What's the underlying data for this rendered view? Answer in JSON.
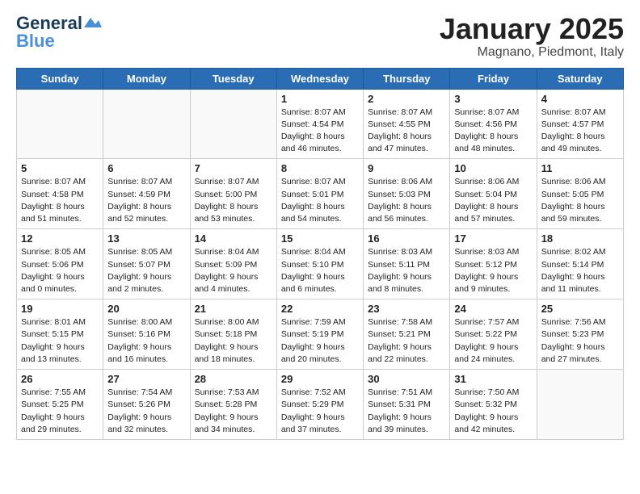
{
  "header": {
    "logo_line1": "General",
    "logo_line2": "Blue",
    "month_title": "January 2025",
    "location": "Magnano, Piedmont, Italy"
  },
  "weekdays": [
    "Sunday",
    "Monday",
    "Tuesday",
    "Wednesday",
    "Thursday",
    "Friday",
    "Saturday"
  ],
  "weeks": [
    [
      {
        "day": "",
        "info": ""
      },
      {
        "day": "",
        "info": ""
      },
      {
        "day": "",
        "info": ""
      },
      {
        "day": "1",
        "info": "Sunrise: 8:07 AM\nSunset: 4:54 PM\nDaylight: 8 hours\nand 46 minutes."
      },
      {
        "day": "2",
        "info": "Sunrise: 8:07 AM\nSunset: 4:55 PM\nDaylight: 8 hours\nand 47 minutes."
      },
      {
        "day": "3",
        "info": "Sunrise: 8:07 AM\nSunset: 4:56 PM\nDaylight: 8 hours\nand 48 minutes."
      },
      {
        "day": "4",
        "info": "Sunrise: 8:07 AM\nSunset: 4:57 PM\nDaylight: 8 hours\nand 49 minutes."
      }
    ],
    [
      {
        "day": "5",
        "info": "Sunrise: 8:07 AM\nSunset: 4:58 PM\nDaylight: 8 hours\nand 51 minutes."
      },
      {
        "day": "6",
        "info": "Sunrise: 8:07 AM\nSunset: 4:59 PM\nDaylight: 8 hours\nand 52 minutes."
      },
      {
        "day": "7",
        "info": "Sunrise: 8:07 AM\nSunset: 5:00 PM\nDaylight: 8 hours\nand 53 minutes."
      },
      {
        "day": "8",
        "info": "Sunrise: 8:07 AM\nSunset: 5:01 PM\nDaylight: 8 hours\nand 54 minutes."
      },
      {
        "day": "9",
        "info": "Sunrise: 8:06 AM\nSunset: 5:03 PM\nDaylight: 8 hours\nand 56 minutes."
      },
      {
        "day": "10",
        "info": "Sunrise: 8:06 AM\nSunset: 5:04 PM\nDaylight: 8 hours\nand 57 minutes."
      },
      {
        "day": "11",
        "info": "Sunrise: 8:06 AM\nSunset: 5:05 PM\nDaylight: 8 hours\nand 59 minutes."
      }
    ],
    [
      {
        "day": "12",
        "info": "Sunrise: 8:05 AM\nSunset: 5:06 PM\nDaylight: 9 hours\nand 0 minutes."
      },
      {
        "day": "13",
        "info": "Sunrise: 8:05 AM\nSunset: 5:07 PM\nDaylight: 9 hours\nand 2 minutes."
      },
      {
        "day": "14",
        "info": "Sunrise: 8:04 AM\nSunset: 5:09 PM\nDaylight: 9 hours\nand 4 minutes."
      },
      {
        "day": "15",
        "info": "Sunrise: 8:04 AM\nSunset: 5:10 PM\nDaylight: 9 hours\nand 6 minutes."
      },
      {
        "day": "16",
        "info": "Sunrise: 8:03 AM\nSunset: 5:11 PM\nDaylight: 9 hours\nand 8 minutes."
      },
      {
        "day": "17",
        "info": "Sunrise: 8:03 AM\nSunset: 5:12 PM\nDaylight: 9 hours\nand 9 minutes."
      },
      {
        "day": "18",
        "info": "Sunrise: 8:02 AM\nSunset: 5:14 PM\nDaylight: 9 hours\nand 11 minutes."
      }
    ],
    [
      {
        "day": "19",
        "info": "Sunrise: 8:01 AM\nSunset: 5:15 PM\nDaylight: 9 hours\nand 13 minutes."
      },
      {
        "day": "20",
        "info": "Sunrise: 8:00 AM\nSunset: 5:16 PM\nDaylight: 9 hours\nand 16 minutes."
      },
      {
        "day": "21",
        "info": "Sunrise: 8:00 AM\nSunset: 5:18 PM\nDaylight: 9 hours\nand 18 minutes."
      },
      {
        "day": "22",
        "info": "Sunrise: 7:59 AM\nSunset: 5:19 PM\nDaylight: 9 hours\nand 20 minutes."
      },
      {
        "day": "23",
        "info": "Sunrise: 7:58 AM\nSunset: 5:21 PM\nDaylight: 9 hours\nand 22 minutes."
      },
      {
        "day": "24",
        "info": "Sunrise: 7:57 AM\nSunset: 5:22 PM\nDaylight: 9 hours\nand 24 minutes."
      },
      {
        "day": "25",
        "info": "Sunrise: 7:56 AM\nSunset: 5:23 PM\nDaylight: 9 hours\nand 27 minutes."
      }
    ],
    [
      {
        "day": "26",
        "info": "Sunrise: 7:55 AM\nSunset: 5:25 PM\nDaylight: 9 hours\nand 29 minutes."
      },
      {
        "day": "27",
        "info": "Sunrise: 7:54 AM\nSunset: 5:26 PM\nDaylight: 9 hours\nand 32 minutes."
      },
      {
        "day": "28",
        "info": "Sunrise: 7:53 AM\nSunset: 5:28 PM\nDaylight: 9 hours\nand 34 minutes."
      },
      {
        "day": "29",
        "info": "Sunrise: 7:52 AM\nSunset: 5:29 PM\nDaylight: 9 hours\nand 37 minutes."
      },
      {
        "day": "30",
        "info": "Sunrise: 7:51 AM\nSunset: 5:31 PM\nDaylight: 9 hours\nand 39 minutes."
      },
      {
        "day": "31",
        "info": "Sunrise: 7:50 AM\nSunset: 5:32 PM\nDaylight: 9 hours\nand 42 minutes."
      },
      {
        "day": "",
        "info": ""
      }
    ]
  ]
}
